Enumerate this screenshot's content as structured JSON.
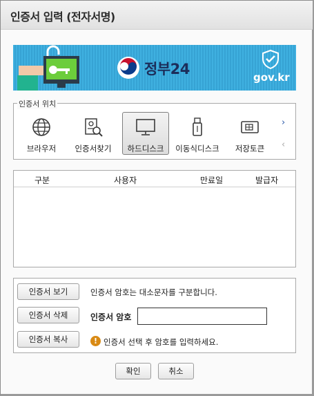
{
  "window": {
    "title": "인증서 입력 (전자서명)"
  },
  "banner": {
    "logo_text": "정부24",
    "domain_text": "gov.kr",
    "icons": [
      "pc-key-illustration-icon",
      "taeguk-logo-icon",
      "shield-check-icon"
    ]
  },
  "location": {
    "legend": "인증서 위치",
    "items": [
      {
        "label": "브라우저",
        "icon": "globe-icon"
      },
      {
        "label": "인증서찾기",
        "icon": "certificate-search-icon"
      },
      {
        "label": "하드디스크",
        "icon": "monitor-icon",
        "selected": true
      },
      {
        "label": "이동식디스크",
        "icon": "usb-icon"
      },
      {
        "label": "저장토큰",
        "icon": "token-card-icon"
      }
    ],
    "next_arrow": "›",
    "prev_arrow": "‹"
  },
  "cert_table": {
    "columns": [
      "구분",
      "사용자",
      "만료일",
      "발급자"
    ],
    "rows": []
  },
  "password": {
    "view_button": "인증서 보기",
    "delete_button": "인증서 삭제",
    "copy_button": "인증서 복사",
    "case_note": "인증서 암호는 대소문자를 구분합니다.",
    "label": "인증서 암호",
    "value": "",
    "hint": "인증서 선택 후 암호를 입력하세요."
  },
  "actions": {
    "ok": "확인",
    "cancel": "취소"
  },
  "colors": {
    "banner": "#37a7d8",
    "warning": "#d98a14",
    "selected_bg": "#dcdcdc"
  }
}
